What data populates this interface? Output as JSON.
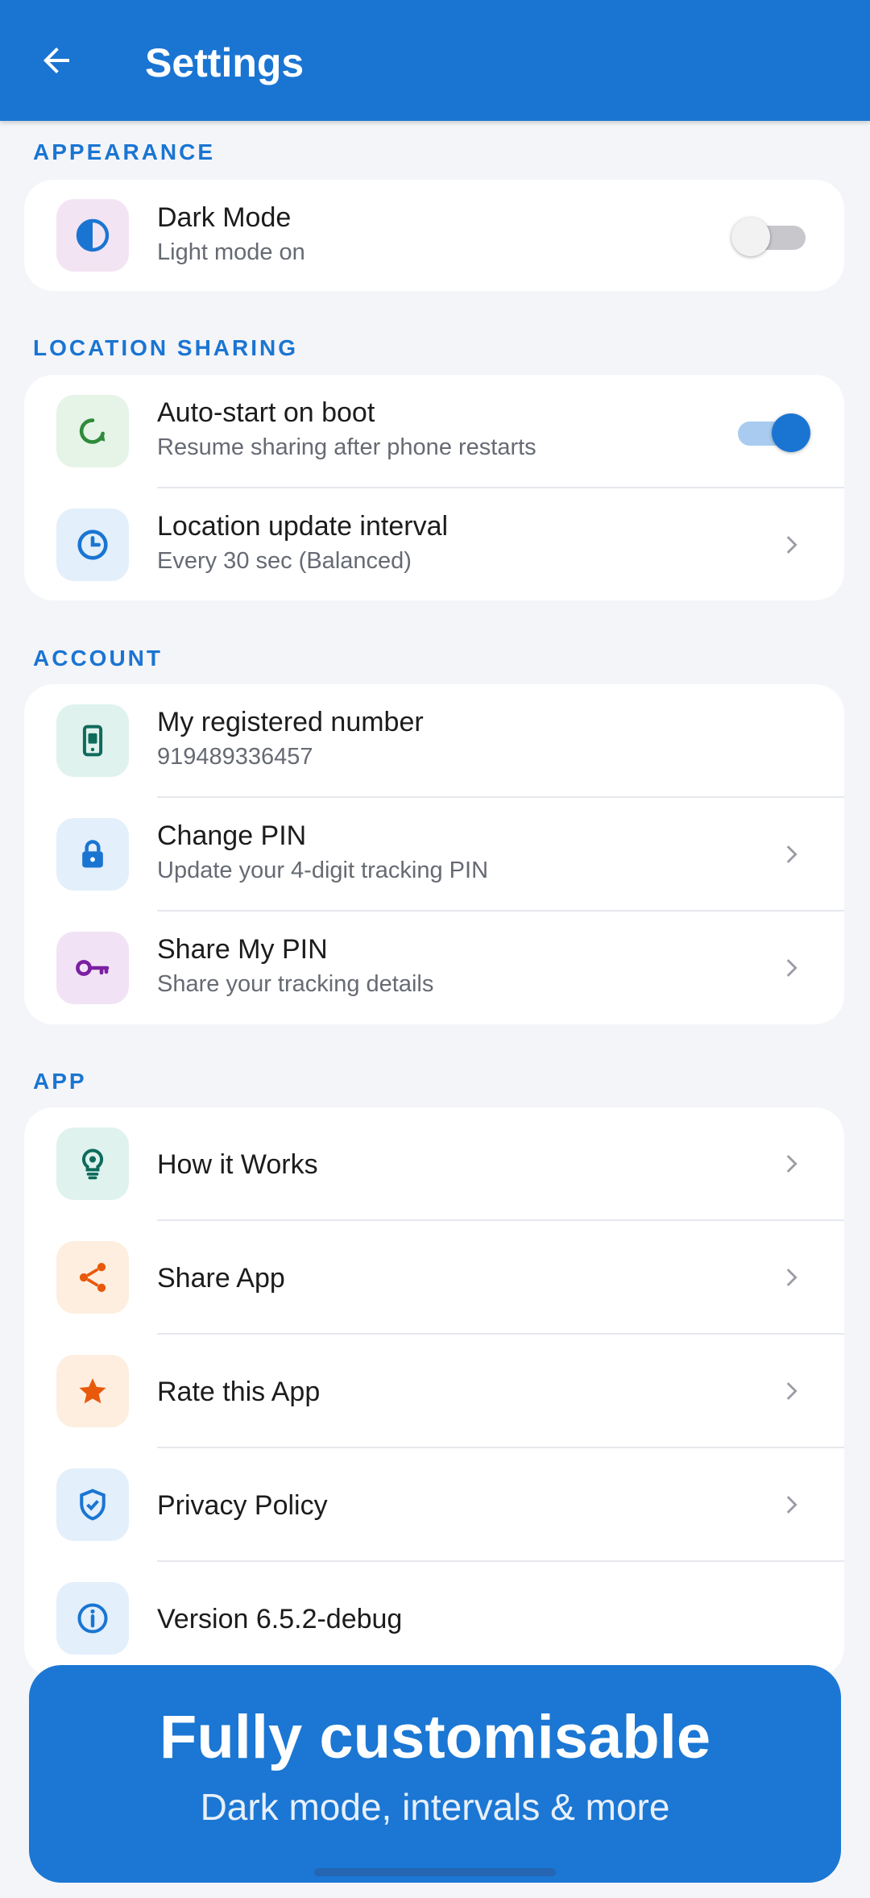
{
  "header": {
    "title": "Settings",
    "back_icon": "arrow-left-icon"
  },
  "colors": {
    "primary": "#1a75d2",
    "background": "#f4f5f9",
    "card": "#ffffff",
    "subtext": "#666a73"
  },
  "sections": {
    "appearance": {
      "label": "APPEARANCE",
      "dark_mode": {
        "title": "Dark Mode",
        "subtitle": "Light mode on",
        "enabled": false,
        "icon": "contrast-icon"
      }
    },
    "location": {
      "label": "LOCATION SHARING",
      "autostart": {
        "title": "Auto-start on boot",
        "subtitle": "Resume sharing after phone restarts",
        "enabled": true,
        "icon": "refresh-icon"
      },
      "interval": {
        "title": "Location update interval",
        "subtitle": "Every 30 sec (Balanced)",
        "icon": "clock-icon"
      }
    },
    "account": {
      "label": "ACCOUNT",
      "number": {
        "title": "My registered number",
        "subtitle": "919489336457",
        "icon": "phone-icon"
      },
      "change_pin": {
        "title": "Change PIN",
        "subtitle": "Update your 4-digit tracking PIN",
        "icon": "lock-icon"
      },
      "share_pin": {
        "title": "Share My PIN",
        "subtitle": "Share your tracking details",
        "icon": "key-icon"
      }
    },
    "app": {
      "label": "APP",
      "how": {
        "title": "How it Works",
        "icon": "lightbulb-icon"
      },
      "share": {
        "title": "Share App",
        "icon": "share-icon"
      },
      "rate": {
        "title": "Rate this App",
        "icon": "star-icon"
      },
      "privacy": {
        "title": "Privacy Policy",
        "icon": "shield-check-icon"
      },
      "version": {
        "title": "Version 6.5.2-debug",
        "icon": "info-icon"
      }
    }
  },
  "banner": {
    "title": "Fully customisable",
    "subtitle": "Dark mode, intervals & more"
  }
}
